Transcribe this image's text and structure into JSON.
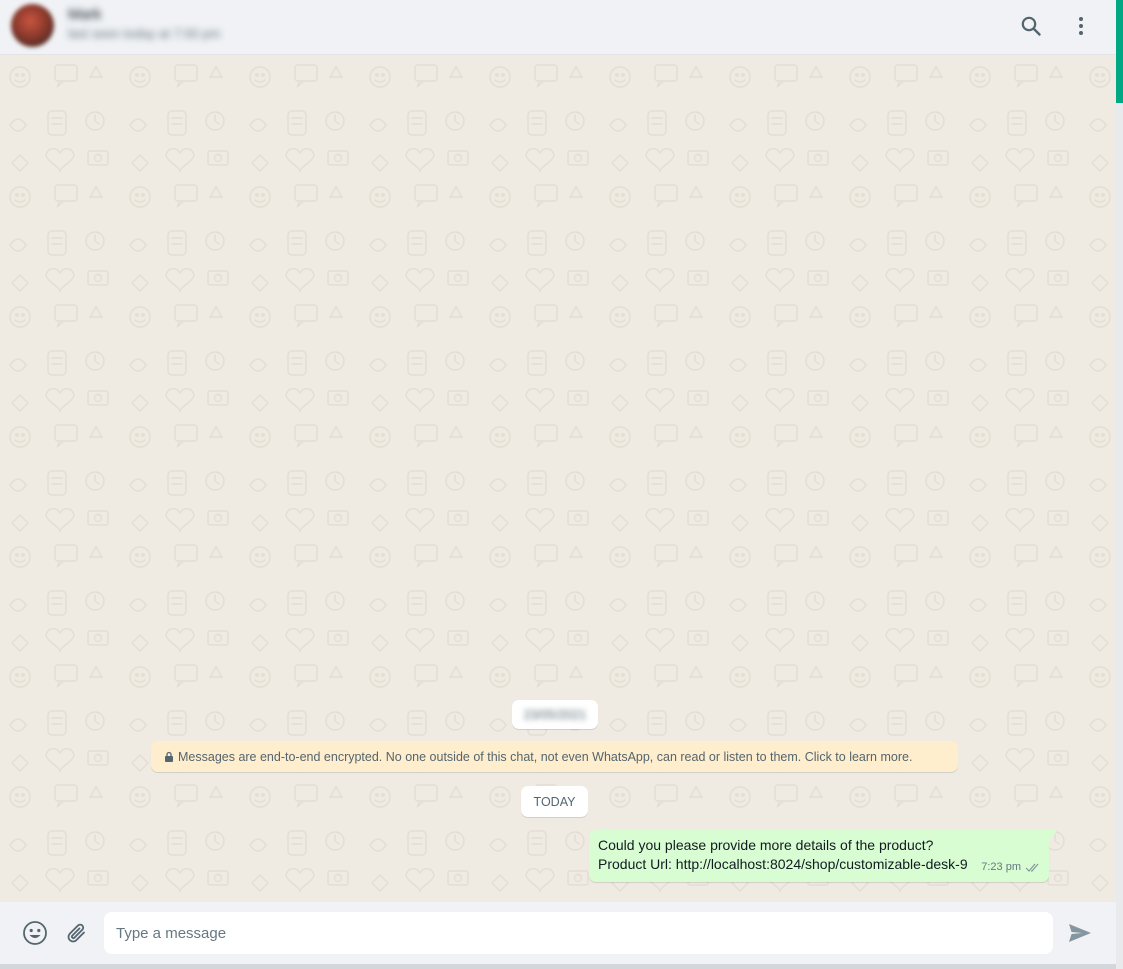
{
  "header": {
    "contact_name": "Mark",
    "contact_status": "last seen today at 7:00 pm",
    "search_icon": "search-icon",
    "menu_icon": "kebab-menu-icon"
  },
  "chat": {
    "date_label": "23/05/2021",
    "encryption_notice": "Messages are end-to-end encrypted. No one outside of this chat, not even WhatsApp, can read or listen to them. Click to learn more.",
    "today_label": "TODAY",
    "messages": [
      {
        "direction": "outgoing",
        "line1": "Could you please provide more details of the product?",
        "line2": "Product Url: http://localhost:8024/shop/customizable-desk-9",
        "time": "7:23 pm",
        "status": "delivered"
      }
    ]
  },
  "composer": {
    "placeholder": "Type a message",
    "value": "",
    "emoji_icon": "emoji-icon",
    "attach_icon": "paperclip-icon",
    "send_icon": "send-icon"
  },
  "colors": {
    "header_bg": "#f0f2f5",
    "chat_bg": "#efeae2",
    "outgoing_bubble": "#d9fdd3",
    "system_notice_bg": "#ffeecd",
    "accent": "#00a884"
  }
}
